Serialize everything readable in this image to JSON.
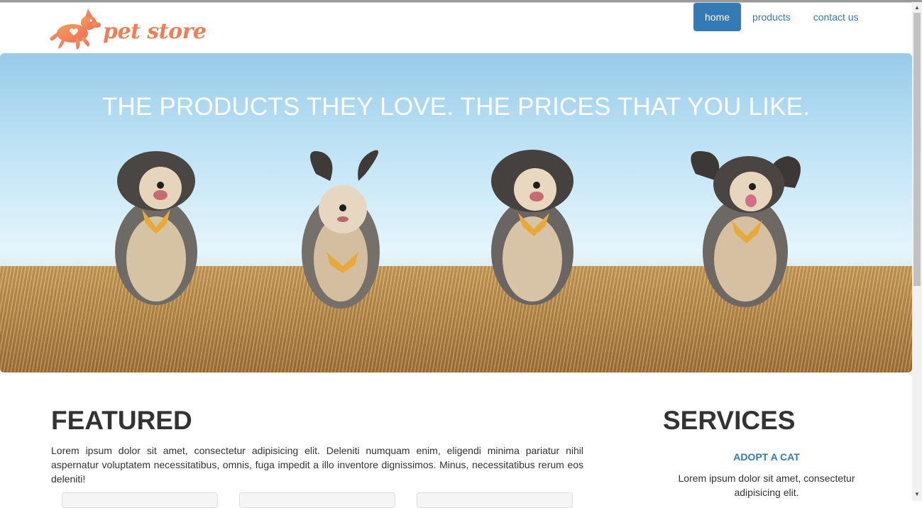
{
  "brand": {
    "logo_text": "pet store",
    "logo_icon": "dog-logo-icon",
    "logo_color": "#f07e55"
  },
  "nav": {
    "items": [
      {
        "label": "home",
        "active": true
      },
      {
        "label": "products",
        "active": false
      },
      {
        "label": "contact us",
        "active": false
      }
    ],
    "accent": "#337ab7"
  },
  "hero": {
    "title": "THE PRODUCTS THEY LOVE. THE PRICES THAT YOU LIKE."
  },
  "featured": {
    "title": "FEATURED",
    "text": "Lorem ipsum dolor sit amet, consectetur adipisicing elit. Deleniti numquam enim, eligendi minima pariatur nihil aspernatur voluptatem necessitatibus, omnis, fuga impedit a illo inventore dignissimos. Minus, necessitatibus rerum eos deleniti!"
  },
  "services": {
    "title": "SERVICES",
    "items": [
      {
        "heading": "ADOPT A CAT",
        "text": "Lorem ipsum dolor sit amet, consectetur adipisicing elit."
      }
    ]
  }
}
